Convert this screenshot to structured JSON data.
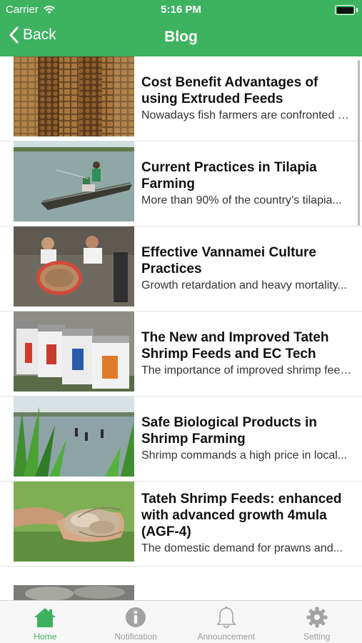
{
  "status_bar": {
    "carrier": "Carrier",
    "time": "5:16 PM"
  },
  "nav": {
    "back_label": "Back",
    "title": "Blog"
  },
  "posts": [
    {
      "title": "Cost Benefit Advantages of using Extruded Feeds",
      "excerpt": "Nowadays fish farmers are confronted with...",
      "image": "feed-pellets-photo"
    },
    {
      "title": "Current Practices in Tilapia Farming",
      "excerpt": "More than 90% of the country’s tilapia...",
      "image": "fisherman-boat-photo"
    },
    {
      "title": "Effective Vannamei Culture Practices",
      "excerpt": "Growth retardation and heavy mortality...",
      "image": "shrimp-harvest-photo"
    },
    {
      "title": "The New and Improved Tateh Shrimp Feeds and EC Tech",
      "excerpt": "The importance of improved shrimp feeds...",
      "image": "feed-bags-photo"
    },
    {
      "title": "Safe Biological Products in Shrimp Farming",
      "excerpt": "Shrimp commands a high price in local...",
      "image": "shrimp-pond-photo"
    },
    {
      "title": "Tateh Shrimp Feeds: enhanced with advanced growth 4mula (AGF-4)",
      "excerpt": "The domestic demand for prawns and...",
      "image": "shrimp-hands-photo"
    },
    {
      "title": "",
      "excerpt": "",
      "image": "shrimp-photo"
    }
  ],
  "tabs": [
    {
      "label": "Home",
      "icon": "home-icon",
      "active": true
    },
    {
      "label": "Notification",
      "icon": "info-icon",
      "active": false
    },
    {
      "label": "Announcement",
      "icon": "bell-icon",
      "active": false
    },
    {
      "label": "Setting",
      "icon": "gear-icon",
      "active": false
    }
  ],
  "colors": {
    "brand_green": "#3db25f",
    "tab_inactive": "#9b9b9b"
  }
}
